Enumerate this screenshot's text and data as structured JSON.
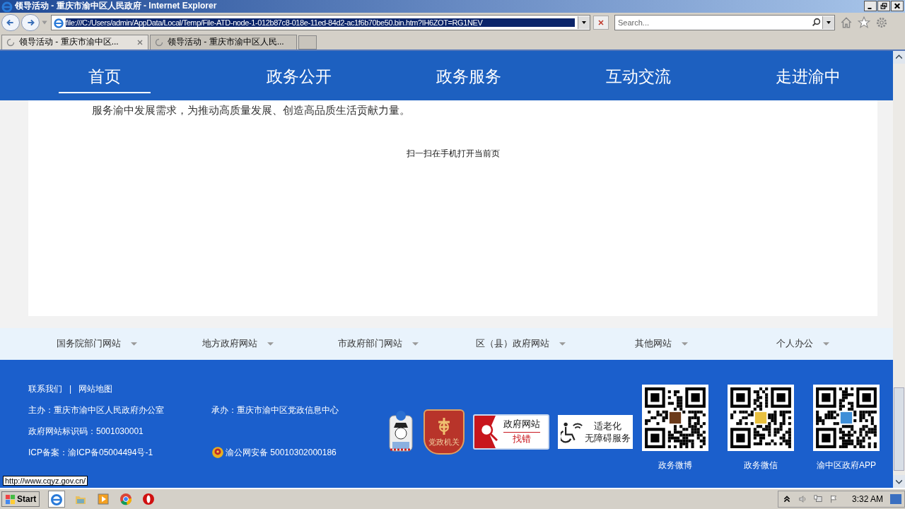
{
  "window": {
    "title": "领导活动 - 重庆市渝中区人民政府 - Internet Explorer"
  },
  "address_bar": {
    "url": "file:///C:/Users/admin/AppData/Local/Temp/File-ATD-node-1-012b87c8-018e-11ed-84d2-ac1f6b70be50.bin.htm?IH6ZOT=RG1NEV"
  },
  "search": {
    "placeholder": "Search..."
  },
  "tabs": [
    {
      "label": "领导活动 - 重庆市渝中区...",
      "selected": true
    },
    {
      "label": "领导活动 - 重庆市渝中区人民...",
      "selected": false
    }
  ],
  "nav": [
    {
      "label": "首页",
      "selected": true
    },
    {
      "label": "政务公开",
      "selected": false
    },
    {
      "label": "政务服务",
      "selected": false
    },
    {
      "label": "互动交流",
      "selected": false
    },
    {
      "label": "走进渝中",
      "selected": false
    }
  ],
  "article": {
    "text": "服务渝中发展需求，为推动高质量发展、创造高品质生活贡献力量。",
    "qr_hint": "扫一扫在手机打开当前页"
  },
  "site_links": [
    "国务院部门网站",
    "地方政府网站",
    "市政府部门网站",
    "区（县）政府网站",
    "其他网站",
    "个人办公"
  ],
  "footer": {
    "links": [
      "联系我们",
      "网站地图"
    ],
    "separator": "|",
    "rows": [
      [
        "主办：重庆市渝中区人民政府办公室",
        "承办：重庆市渝中区党政信息中心"
      ],
      [
        "政府网站标识码：5001030001",
        ""
      ],
      [
        "ICP备案：渝ICP备05004494号-1",
        "渝公网安备 50010302000186"
      ]
    ],
    "badges": [
      {
        "kind": "police"
      },
      {
        "kind": "party",
        "label": "党政机关"
      },
      {
        "kind": "error",
        "lines": [
          "政府网站",
          "找错"
        ]
      },
      {
        "kind": "access",
        "lines": [
          "适老化",
          "无障碍服务"
        ]
      }
    ],
    "qr_codes": [
      "政务微博",
      "政务微信",
      "渝中区政府APP"
    ]
  },
  "status_tooltip": "http://www.cqyz.gov.cn/",
  "taskbar": {
    "start": "Start",
    "clock": "3:32 AM"
  }
}
